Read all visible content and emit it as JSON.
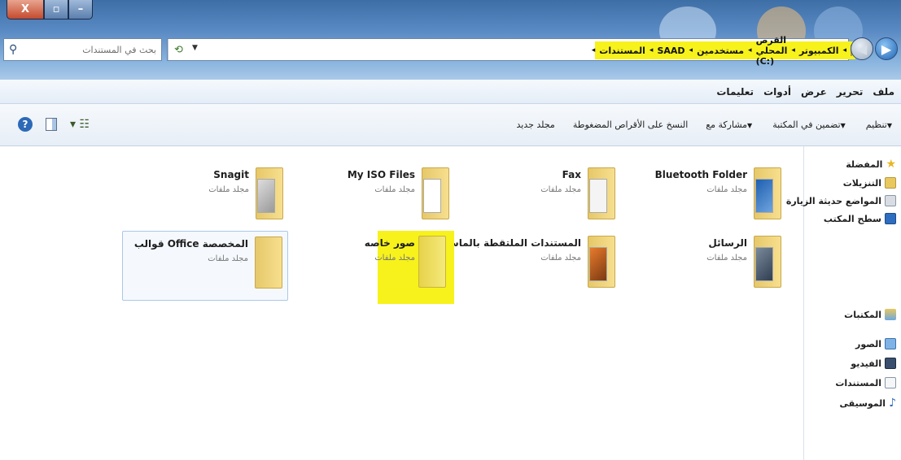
{
  "window": {
    "buttons": {
      "close": "X",
      "maximize": "▫",
      "minimize": "–"
    }
  },
  "address_bar": {
    "breadcrumbs": [
      "الكمبيوتر",
      "القرص المحلي (C:)",
      "مستخدمين",
      "SAAD",
      "المستندات"
    ],
    "search_placeholder": "بحث في المستندات"
  },
  "menu": [
    "ملف",
    "تحرير",
    "عرض",
    "أدوات",
    "تعليمات"
  ],
  "commands": [
    {
      "label": "تنظيم",
      "dropdown": true
    },
    {
      "label": "تضمين في المكتبة",
      "dropdown": true
    },
    {
      "label": "مشاركة مع",
      "dropdown": true
    },
    {
      "label": "النسخ على الأقراص المضغوطة",
      "dropdown": false
    },
    {
      "label": "مجلد جديد",
      "dropdown": false
    }
  ],
  "nav_pane": {
    "favorites_header": "المفضلة",
    "favorites": [
      "التنزيلات",
      "المواضع حديثة الزيارة",
      "سطح المكتب"
    ],
    "libraries_header": "المكتبات",
    "libraries": [
      "الصور",
      "الفيديو",
      "المستندات",
      "الموسيقى"
    ]
  },
  "folders": [
    {
      "name": "Bluetooth Folder",
      "type": "مجلد ملفات"
    },
    {
      "name": "Fax",
      "type": "مجلد ملفات"
    },
    {
      "name": "My ISO Files",
      "type": "مجلد ملفات"
    },
    {
      "name": "Snagit",
      "type": "مجلد ملفات"
    },
    {
      "name": "الرسائل",
      "type": "مجلد ملفات"
    },
    {
      "name": "المستندات الملتقطة بالماسح الضوئي",
      "type": "مجلد ملفات"
    },
    {
      "name": "صور خاصه",
      "type": "مجلد ملفات",
      "highlighted": true
    },
    {
      "name": "قوالب Office المخصصة",
      "type": "مجلد ملفات",
      "selected": true
    }
  ],
  "colors": {
    "highlight": "#f7f21b",
    "glass": "#5b8bc4"
  }
}
